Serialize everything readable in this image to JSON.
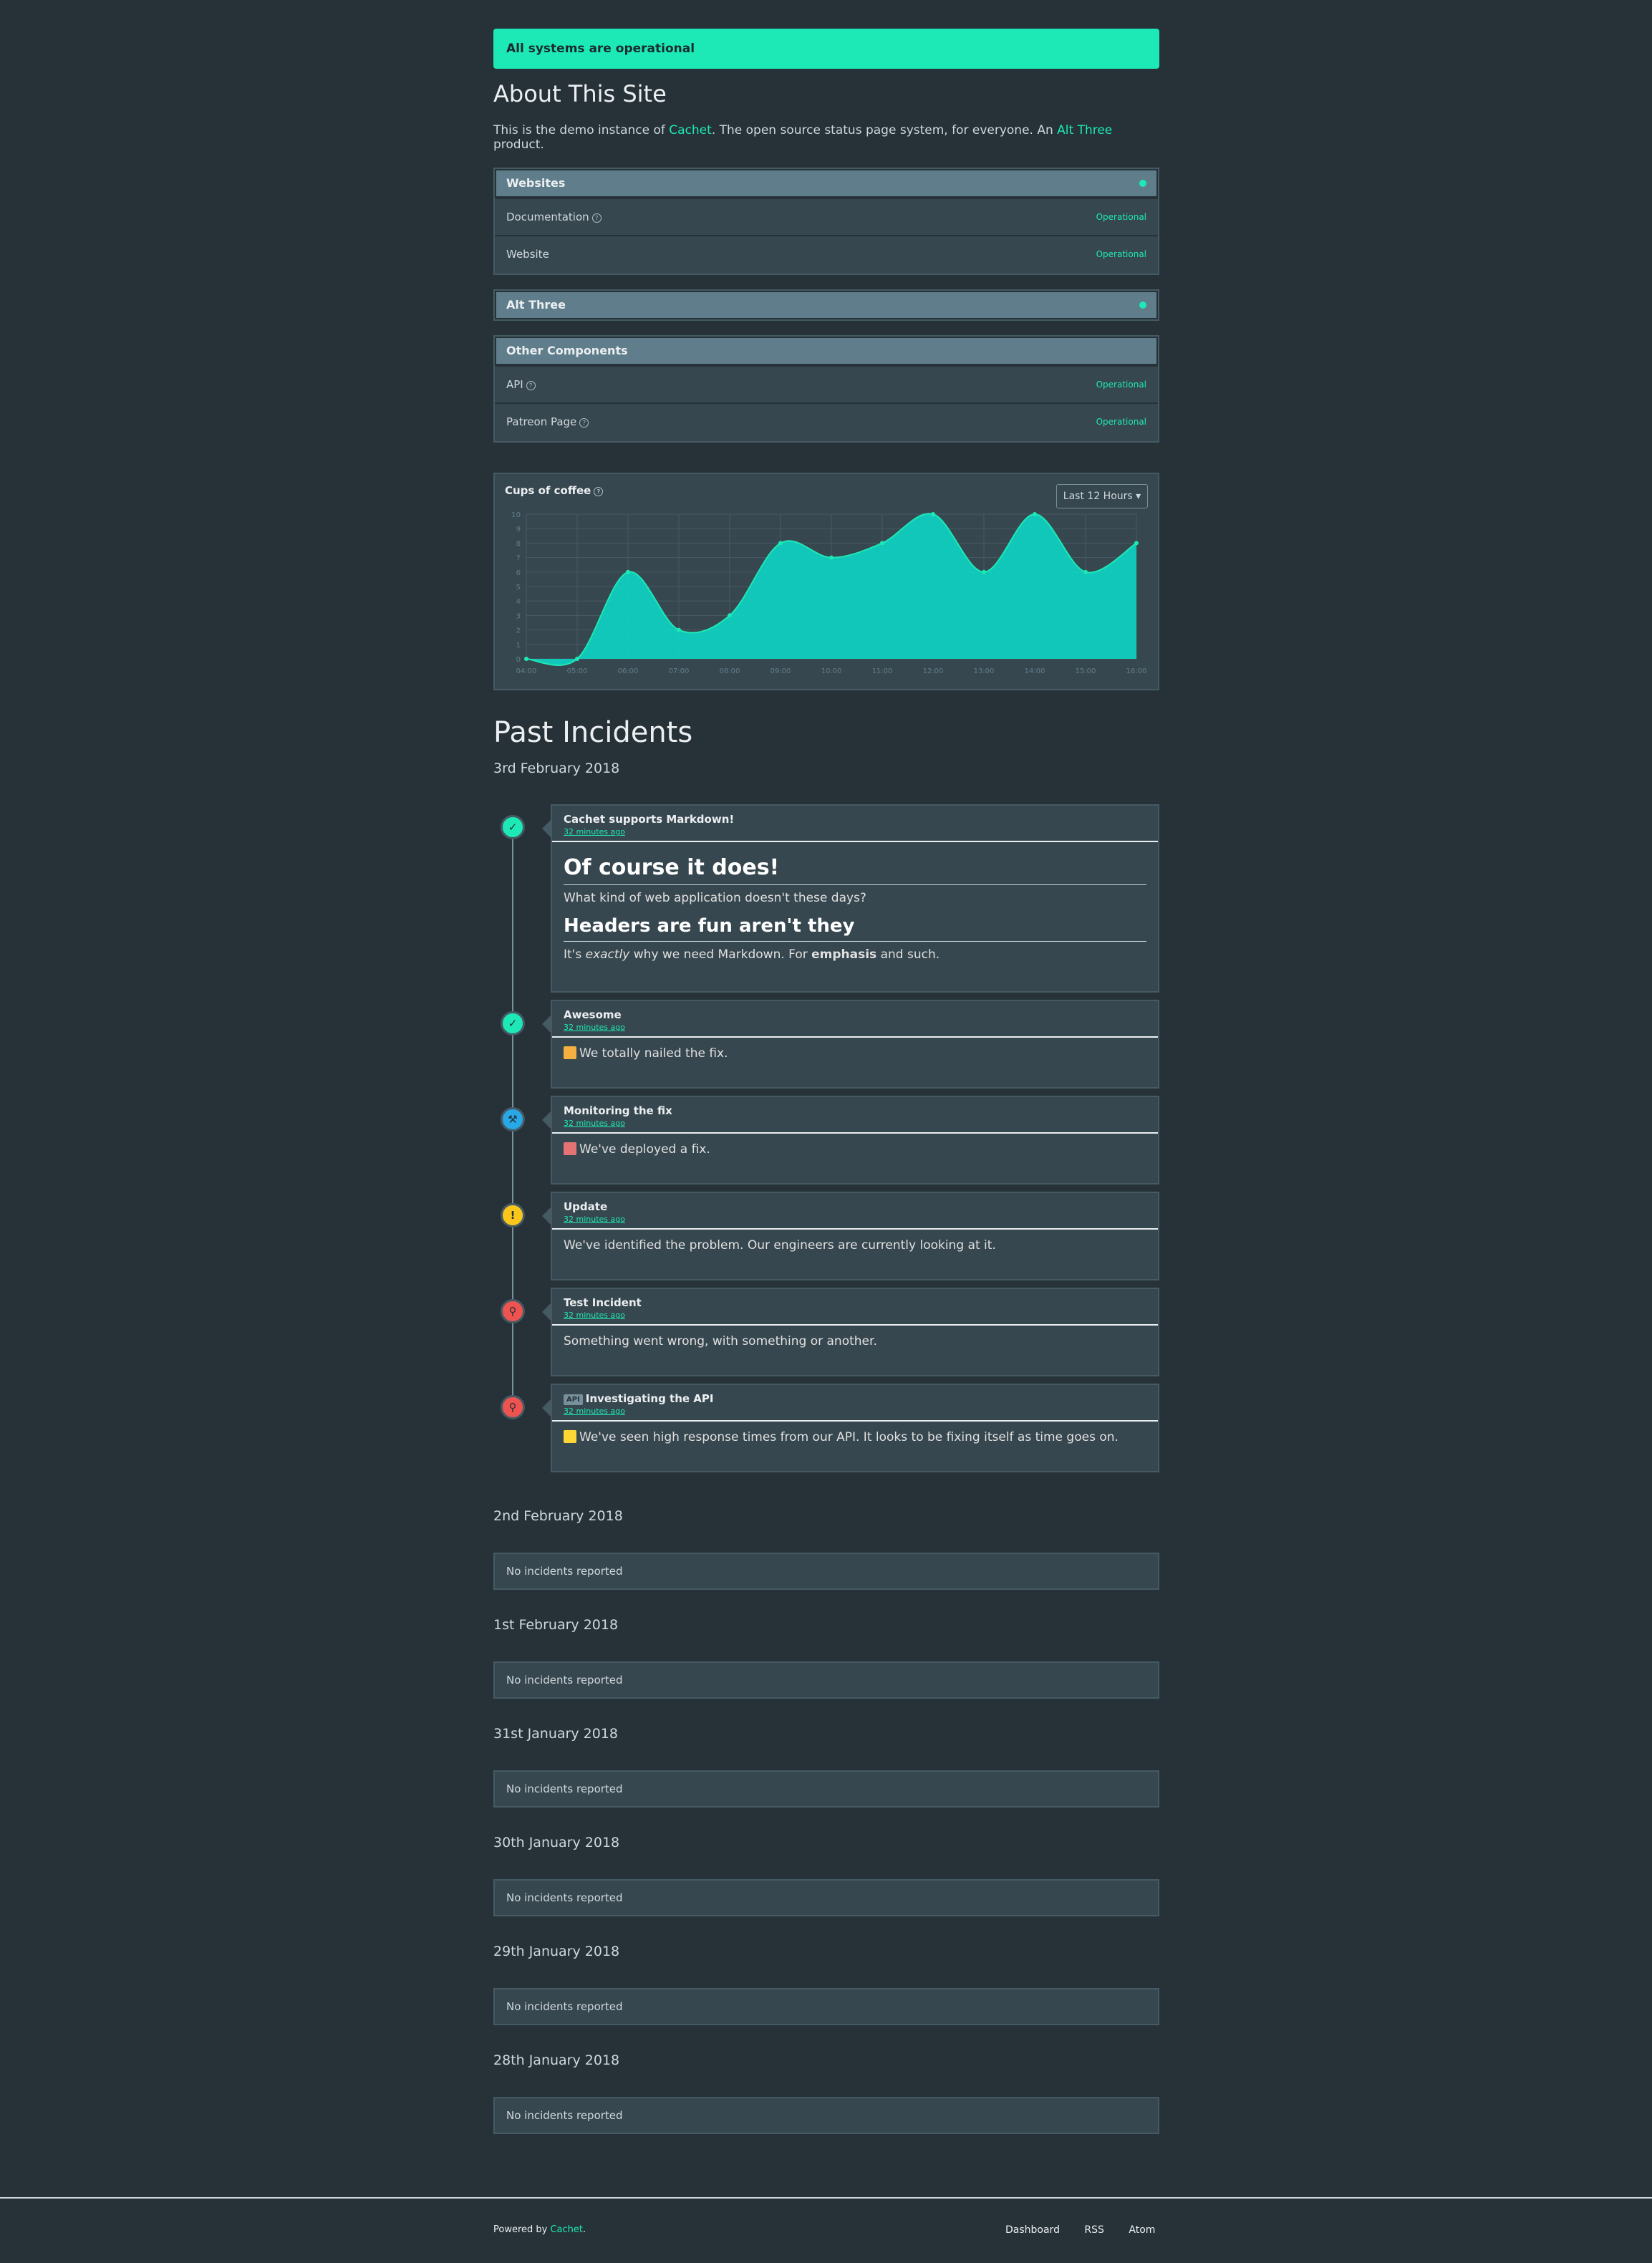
{
  "banner": "All systems are operational",
  "about": {
    "title": "About This Site",
    "text_before": "This is the demo instance of ",
    "link1": "Cachet",
    "text_middle": ". The open source status page system, for everyone. An ",
    "link2": "Alt Three",
    "text_after": " product."
  },
  "groups": [
    {
      "name": "Websites",
      "components": [
        {
          "name": "Documentation",
          "status": "Operational",
          "help": true
        },
        {
          "name": "Website",
          "status": "Operational",
          "help": false
        }
      ]
    },
    {
      "name": "Alt Three",
      "components": []
    },
    {
      "name": "Other Components",
      "components": [
        {
          "name": "API",
          "status": "Operational",
          "help": true
        },
        {
          "name": "Patreon Page",
          "status": "Operational",
          "help": true
        }
      ]
    }
  ],
  "metric": {
    "title": "Cups of coffee",
    "range_select": "Last 12 Hours",
    "chart_data": {
      "type": "area",
      "title": "Cups of coffee",
      "x": [
        "04:00",
        "05:00",
        "06:00",
        "07:00",
        "08:00",
        "09:00",
        "10:00",
        "11:00",
        "12:00",
        "13:00",
        "14:00",
        "15:00",
        "16:00"
      ],
      "values": [
        0,
        0,
        6,
        2,
        3,
        8,
        7,
        8,
        10,
        6,
        10,
        6,
        8
      ],
      "ylim": [
        0,
        10
      ],
      "yticks": [
        "0",
        "1",
        "2",
        "3",
        "4",
        "5",
        "6",
        "7",
        "8",
        "9",
        "10"
      ],
      "grid": true,
      "color": "#0fcfbf"
    }
  },
  "past_incidents_title": "Past Incidents",
  "dates": {
    "d1": "3rd February 2018",
    "d2": "2nd February 2018",
    "d3": "1st February 2018",
    "d4": "31st January 2018",
    "d5": "30th January 2018",
    "d6": "29th January 2018",
    "d7": "28th January 2018"
  },
  "no_incidents": "No incidents reported",
  "incidents": [
    {
      "name": "Cachet supports Markdown!",
      "time": "32 minutes ago",
      "icon": "check-icon",
      "color": "#1de9b6",
      "h1": "Of course it does!",
      "p1": "What kind of web application doesn't these days?",
      "h2": "Headers are fun aren't they",
      "p2_a": "It's ",
      "p2_em": "exactly",
      "p2_b": " why we need Markdown. For ",
      "p2_strong": "emphasis",
      "p2_c": " and such."
    },
    {
      "name": "Awesome",
      "time": "32 minutes ago",
      "icon": "check-icon",
      "color": "#1de9b6",
      "body": "We totally nailed the fix."
    },
    {
      "name": "Monitoring the fix",
      "time": "32 minutes ago",
      "icon": "wrench-icon",
      "color": "#29a8e8",
      "body": "We've deployed a fix."
    },
    {
      "name": "Update",
      "time": "32 minutes ago",
      "icon": "exclamation-icon",
      "color": "#f9c61b",
      "body": "We've identified the problem. Our engineers are currently looking at it."
    },
    {
      "name": "Test Incident",
      "time": "32 minutes ago",
      "icon": "search-icon",
      "color": "#ef5350",
      "body": "Something went wrong, with something or another."
    },
    {
      "name": "Investigating the API",
      "badge": "API",
      "time": "32 minutes ago",
      "icon": "search-icon",
      "color": "#ef5350",
      "body": "We've seen high response times from our API. It looks to be fixing itself as time goes on."
    }
  ],
  "footer": {
    "powered_text": "Powered by ",
    "powered_link": "Cachet",
    "powered_end": ".",
    "links": [
      "Dashboard",
      "RSS",
      "Atom"
    ]
  }
}
